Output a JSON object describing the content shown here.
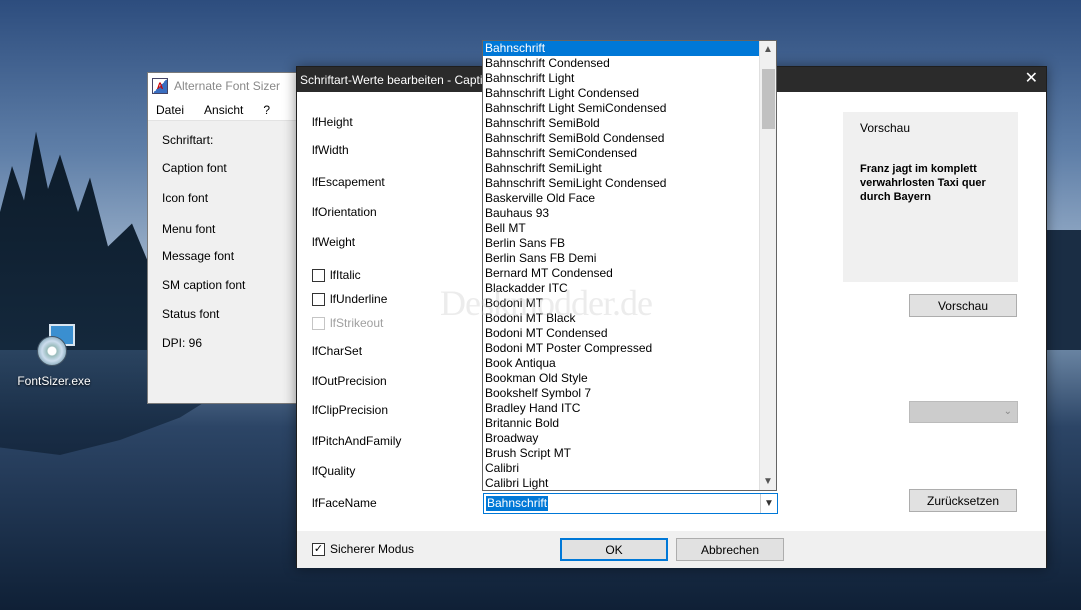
{
  "desktop": {
    "icon_label": "FontSizer.exe"
  },
  "back_window": {
    "title": "Alternate Font Sizer",
    "menu": [
      "Datei",
      "Ansicht",
      "?"
    ],
    "items": [
      "Schriftart:",
      "Caption font",
      "Icon font",
      "Menu font",
      "Message font",
      "SM caption font",
      "Status font",
      "DPI: 96"
    ]
  },
  "dialog": {
    "title": "Schriftart-Werte bearbeiten - Capti",
    "fields": [
      "lfHeight",
      "lfWidth",
      "lfEscapement",
      "lfOrientation",
      "lfWeight"
    ],
    "checkboxes": [
      {
        "label": "lfItalic",
        "checked": false,
        "enabled": true
      },
      {
        "label": "lfUnderline",
        "checked": false,
        "enabled": true
      },
      {
        "label": "lfStrikeout",
        "checked": false,
        "enabled": false
      }
    ],
    "fields2": [
      "lfCharSet",
      "lfOutPrecision",
      "lfClipPrecision",
      "lfPitchAndFamily",
      "lfQuality",
      "lfFaceName"
    ],
    "preview": {
      "title": "Vorschau",
      "sample": "Franz jagt im komplett verwahrlosten Taxi quer durch Bayern"
    },
    "preview_button": "Vorschau",
    "reset_button": "Zurücksetzen",
    "face_value": "Bahnschrift",
    "safe_mode": {
      "label": "Sicherer Modus",
      "checked": true
    },
    "ok_button": "OK",
    "cancel_button": "Abbrechen"
  },
  "dropdown": {
    "selected": "Bahnschrift",
    "items": [
      "Bahnschrift",
      "Bahnschrift Condensed",
      "Bahnschrift Light",
      "Bahnschrift Light Condensed",
      "Bahnschrift Light SemiCondensed",
      "Bahnschrift SemiBold",
      "Bahnschrift SemiBold Condensed",
      "Bahnschrift SemiCondensed",
      "Bahnschrift SemiLight",
      "Bahnschrift SemiLight Condensed",
      "Baskerville Old Face",
      "Bauhaus 93",
      "Bell MT",
      "Berlin Sans FB",
      "Berlin Sans FB Demi",
      "Bernard MT Condensed",
      "Blackadder ITC",
      "Bodoni MT",
      "Bodoni MT Black",
      "Bodoni MT Condensed",
      "Bodoni MT Poster Compressed",
      "Book Antiqua",
      "Bookman Old Style",
      "Bookshelf Symbol 7",
      "Bradley Hand ITC",
      "Britannic Bold",
      "Broadway",
      "Brush Script MT",
      "Calibri",
      "Calibri Light"
    ]
  },
  "watermark": "Deskmodder.de"
}
